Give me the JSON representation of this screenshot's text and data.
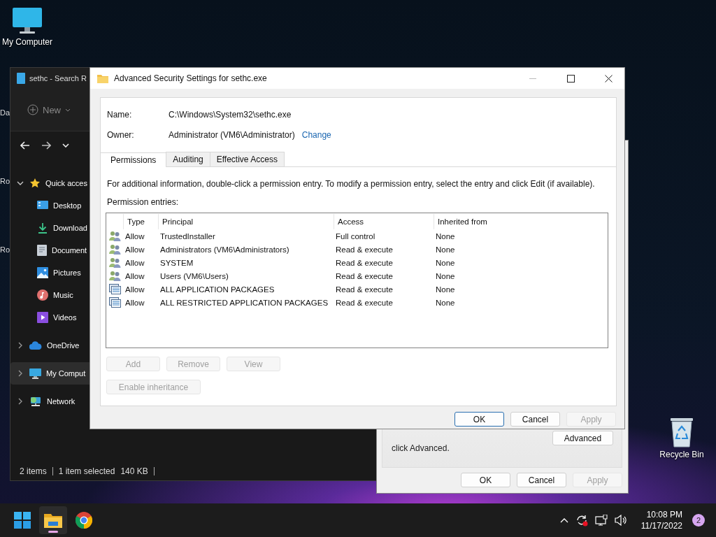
{
  "desktop": {
    "icons": [
      {
        "label": "My Computer",
        "kind": "computer"
      },
      {
        "label": "Recycle Bin",
        "kind": "recycle"
      }
    ],
    "edge_labels": [
      "Da",
      "Ro",
      "Ro"
    ]
  },
  "explorer": {
    "title": "sethc - Search R",
    "new_button": "New",
    "sidebar": [
      {
        "label": "Quick acces",
        "kind": "star",
        "expanded": true,
        "selected": false,
        "children": [
          {
            "label": "Desktop",
            "kind": "desktop",
            "selected": false
          },
          {
            "label": "Download",
            "kind": "download",
            "selected": false
          },
          {
            "label": "Document",
            "kind": "document",
            "selected": false
          },
          {
            "label": "Pictures",
            "kind": "pictures",
            "selected": false
          },
          {
            "label": "Music",
            "kind": "music",
            "selected": false
          },
          {
            "label": "Videos",
            "kind": "videos",
            "selected": false
          }
        ]
      },
      {
        "label": "OneDrive",
        "kind": "cloud",
        "expanded": false,
        "selected": false
      },
      {
        "label": "My Comput",
        "kind": "computer",
        "expanded": false,
        "selected": true
      },
      {
        "label": "Network",
        "kind": "network",
        "expanded": false,
        "selected": false
      }
    ],
    "status": [
      "2 items",
      "1 item selected",
      "140 KB"
    ]
  },
  "properties_dialog": {
    "text": "click Advanced.",
    "advanced_button": "Advanced",
    "buttons": [
      {
        "label": "OK",
        "disabled": false
      },
      {
        "label": "Cancel",
        "disabled": false
      },
      {
        "label": "Apply",
        "disabled": true
      }
    ]
  },
  "security_dialog": {
    "title": "Advanced Security Settings for sethc.exe",
    "name_label": "Name:",
    "name_value": "C:\\Windows\\System32\\sethc.exe",
    "owner_label": "Owner:",
    "owner_value": "Administrator (VM6\\Administrator)",
    "owner_link": "Change",
    "tabs": [
      {
        "label": "Permissions",
        "selected": true
      },
      {
        "label": "Auditing",
        "selected": false
      },
      {
        "label": "Effective Access",
        "selected": false
      }
    ],
    "info": "For additional information, double-click a permission entry. To modify a permission entry, select the entry and click Edit (if available).",
    "entries_label": "Permission entries:",
    "columns": [
      "Type",
      "Principal",
      "Access",
      "Inherited from"
    ],
    "rows": [
      {
        "kind": "group",
        "type": "Allow",
        "principal": "TrustedInstaller",
        "access": "Full control",
        "inherited": "None"
      },
      {
        "kind": "group",
        "type": "Allow",
        "principal": "Administrators (VM6\\Administrators)",
        "access": "Read & execute",
        "inherited": "None"
      },
      {
        "kind": "group",
        "type": "Allow",
        "principal": "SYSTEM",
        "access": "Read & execute",
        "inherited": "None"
      },
      {
        "kind": "group",
        "type": "Allow",
        "principal": "Users (VM6\\Users)",
        "access": "Read & execute",
        "inherited": "None"
      },
      {
        "kind": "package",
        "type": "Allow",
        "principal": "ALL APPLICATION PACKAGES",
        "access": "Read & execute",
        "inherited": "None"
      },
      {
        "kind": "package",
        "type": "Allow",
        "principal": "ALL RESTRICTED APPLICATION PACKAGES",
        "access": "Read & execute",
        "inherited": "None"
      }
    ],
    "entry_buttons": [
      {
        "label": "Add",
        "disabled": true
      },
      {
        "label": "Remove",
        "disabled": true
      },
      {
        "label": "View",
        "disabled": true
      }
    ],
    "inheritance_button": {
      "label": "Enable inheritance",
      "disabled": true
    },
    "buttons": [
      {
        "label": "OK",
        "disabled": false,
        "default": true
      },
      {
        "label": "Cancel",
        "disabled": false,
        "default": false
      },
      {
        "label": "Apply",
        "disabled": true,
        "default": false
      }
    ]
  },
  "taskbar": {
    "apps": [
      {
        "kind": "start",
        "active": false
      },
      {
        "kind": "explorer",
        "active": true
      },
      {
        "kind": "chrome",
        "active": false
      }
    ],
    "time": "10:08 PM",
    "date": "11/17/2022",
    "notifications": "2"
  }
}
